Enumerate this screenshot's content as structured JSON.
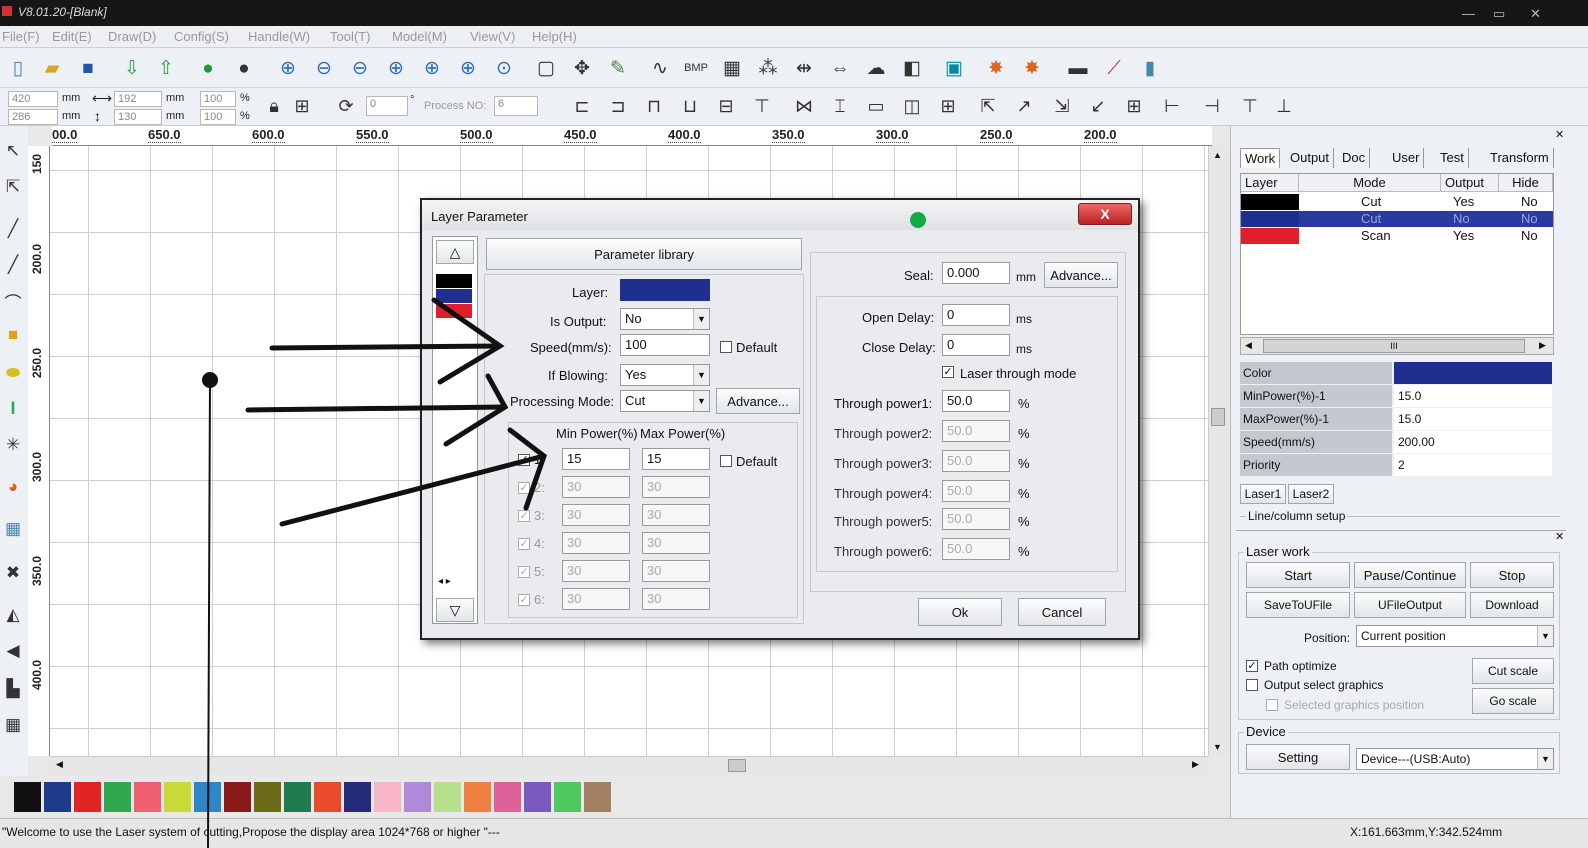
{
  "window": {
    "title": "V8.01.20-[Blank]"
  },
  "menu": [
    "File(F)",
    "Edit(E)",
    "Draw(D)",
    "Config(S)",
    "Handle(W)",
    "Tool(T)",
    "Model(M)",
    "View(V)",
    "Help(H)"
  ],
  "toolbar2": {
    "x_pos": "420",
    "y_pos": "286",
    "width": "192",
    "height": "130",
    "unit": "mm",
    "scale_x": "100",
    "scale_y": "100",
    "pct": "%",
    "rotate": "0",
    "deg": "°",
    "process_no_label": "Process NO:",
    "process_no": "6"
  },
  "ruler_h": [
    "00.0",
    "650.0",
    "600.0",
    "550.0",
    "500.0",
    "450.0",
    "400.0",
    "350.0",
    "300.0",
    "250.0",
    "200.0"
  ],
  "ruler_v": [
    "150",
    "200.0",
    "250.0",
    "300.0",
    "350.0",
    "400.0"
  ],
  "palette": [
    "#111111",
    "#1e3a8a",
    "#e02424",
    "#2fa84f",
    "#f06070",
    "#c8d93a",
    "#2e86c8",
    "#8b1a1a",
    "#6b6b1a",
    "#1f7a4d",
    "#e84a2a",
    "#262a7a",
    "#f7b6c8",
    "#b08ad8",
    "#b6e08a",
    "#f08040",
    "#e0609a",
    "#7a5ac0",
    "#50c860",
    "#a08060"
  ],
  "status": {
    "message": "\"Welcome to use the Laser system of cutting,Propose the display area 1024*768 or higher \"---",
    "coords": "X:161.663mm,Y:342.524mm"
  },
  "right_panel": {
    "tabs": [
      "Work",
      "Output",
      "Doc",
      "User",
      "Test",
      "Transform"
    ],
    "layer_headers": [
      "Layer",
      "Mode",
      "Output",
      "Hide"
    ],
    "layers": [
      {
        "color": "#000000",
        "mode": "Cut",
        "output": "Yes",
        "hide": "No",
        "selected": false
      },
      {
        "color": "#1e2f8f",
        "mode": "Cut",
        "output": "No",
        "hide": "No",
        "selected": true
      },
      {
        "color": "#e01f2a",
        "mode": "Scan",
        "output": "Yes",
        "hide": "No",
        "selected": false
      }
    ],
    "scroll_grip": "III",
    "props": [
      {
        "key": "Color",
        "value": "",
        "color": "#1e2f8f"
      },
      {
        "key": "MinPower(%)-1",
        "value": "15.0"
      },
      {
        "key": "MaxPower(%)-1",
        "value": "15.0"
      },
      {
        "key": "Speed(mm/s)",
        "value": "200.00"
      },
      {
        "key": "Priority",
        "value": "2"
      }
    ],
    "laser_tabs": [
      "Laser1",
      "Laser2"
    ],
    "line_column_setup": "Line/column setup",
    "laser_work": {
      "label": "Laser work",
      "buttons": [
        "Start",
        "Pause/Continue",
        "Stop",
        "SaveToUFile",
        "UFileOutput",
        "Download"
      ],
      "position_label": "Position:",
      "position_value": "Current position",
      "path_optimize": "Path optimize",
      "output_select": "Output select graphics",
      "selected_position": "Selected graphics position",
      "cut_scale": "Cut scale",
      "go_scale": "Go scale"
    },
    "device": {
      "label": "Device",
      "setting": "Setting",
      "value": "Device---(USB:Auto)"
    }
  },
  "dialog": {
    "title": "Layer Parameter",
    "close": "X",
    "param_library": "Parameter library",
    "layer_label": "Layer:",
    "layer_color": "#1e2f8f",
    "is_output_label": "Is Output:",
    "is_output": "No",
    "speed_label": "Speed(mm/s):",
    "speed": "100",
    "default_label": "Default",
    "blowing_label": "If Blowing:",
    "blowing": "Yes",
    "mode_label": "Processing Mode:",
    "mode": "Cut",
    "advance": "Advance...",
    "min_power_hdr": "Min Power(%)",
    "max_power_hdr": "Max Power(%)",
    "power_rows": [
      {
        "n": "1:",
        "min": "15",
        "max": "15"
      },
      {
        "n": "2:",
        "min": "30",
        "max": "30"
      },
      {
        "n": "3:",
        "min": "30",
        "max": "30"
      },
      {
        "n": "4:",
        "min": "30",
        "max": "30"
      },
      {
        "n": "5:",
        "min": "30",
        "max": "30"
      },
      {
        "n": "6:",
        "min": "30",
        "max": "30"
      }
    ],
    "seal_label": "Seal:",
    "seal": "0.000",
    "seal_unit": "mm",
    "open_delay_label": "Open Delay:",
    "open_delay": "0",
    "close_delay_label": "Close Delay:",
    "close_delay": "0",
    "ms": "ms",
    "through_mode": "Laser through mode",
    "through": [
      {
        "label": "Through power1:",
        "value": "50.0"
      },
      {
        "label": "Through power2:",
        "value": "50.0"
      },
      {
        "label": "Through power3:",
        "value": "50.0"
      },
      {
        "label": "Through power4:",
        "value": "50.0"
      },
      {
        "label": "Through power5:",
        "value": "50.0"
      },
      {
        "label": "Through power6:",
        "value": "50.0"
      }
    ],
    "ok": "Ok",
    "cancel": "Cancel"
  }
}
